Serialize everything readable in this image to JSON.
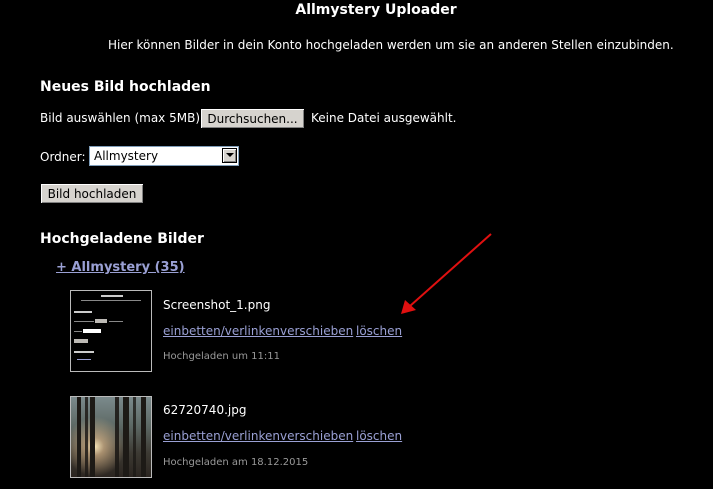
{
  "header": {
    "title": "Allmystery Uploader",
    "intro": "Hier können Bilder in dein Konto hochgeladen werden um sie an anderen Stellen einzubinden."
  },
  "upload": {
    "section_title": "Neues Bild hochladen",
    "file_label": "Bild auswählen (max 5MB):",
    "browse_label": "Durchsuchen...",
    "no_file_text": "Keine Datei ausgewählt.",
    "folder_label": "Ordner:",
    "folder_selected": "Allmystery",
    "submit_label": "Bild hochladen"
  },
  "gallery": {
    "section_title": "Hochgeladene Bilder",
    "folder_link": "+ Allmystery (35)",
    "images": [
      {
        "filename": "Screenshot_1.png",
        "embed_label": "einbetten/verlinken",
        "move_label": "verschieben",
        "delete_label": "löschen",
        "uploaded": "Hochgeladen um 11:11"
      },
      {
        "filename": "62720740.jpg",
        "embed_label": "einbetten/verlinken",
        "move_label": "verschieben",
        "delete_label": "löschen",
        "uploaded": "Hochgeladen am 18.12.2015"
      }
    ]
  },
  "colors": {
    "background": "#000000",
    "text": "#ffffff",
    "link": "#9aa0d4",
    "muted": "#999999",
    "annotation_arrow": "#e01010"
  },
  "icons": {
    "dropdown": "chevron-down-icon",
    "annotation": "red-arrow-icon"
  }
}
